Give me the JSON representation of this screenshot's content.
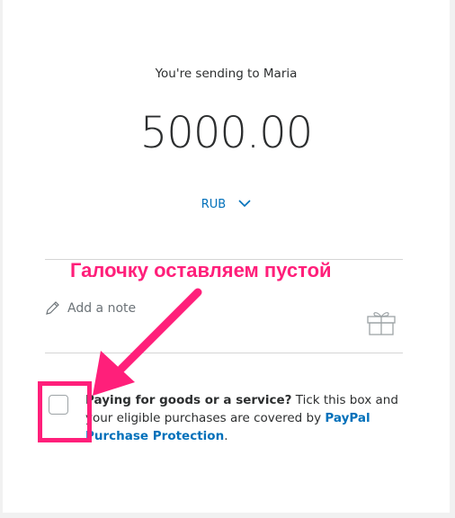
{
  "header": {
    "title": "You're sending to Maria"
  },
  "amount": {
    "value": "5000.00"
  },
  "currency": {
    "code": "RUB",
    "icon": "chevron-down-icon"
  },
  "note": {
    "placeholder": "Add a note",
    "icon": "pencil-icon",
    "gift_icon": "gift-icon"
  },
  "goods": {
    "bold": "Paying for goods or a service?",
    "text": " Tick this box and your eligible purchases are covered by ",
    "link": "PayPal Purchase Protection",
    "end": ".",
    "checked": false
  },
  "annotation": {
    "text": "Галочку оставляем пустой",
    "color": "#ff1f7a"
  },
  "colors": {
    "link": "#0070ba",
    "highlight": "#ff1f7a"
  }
}
